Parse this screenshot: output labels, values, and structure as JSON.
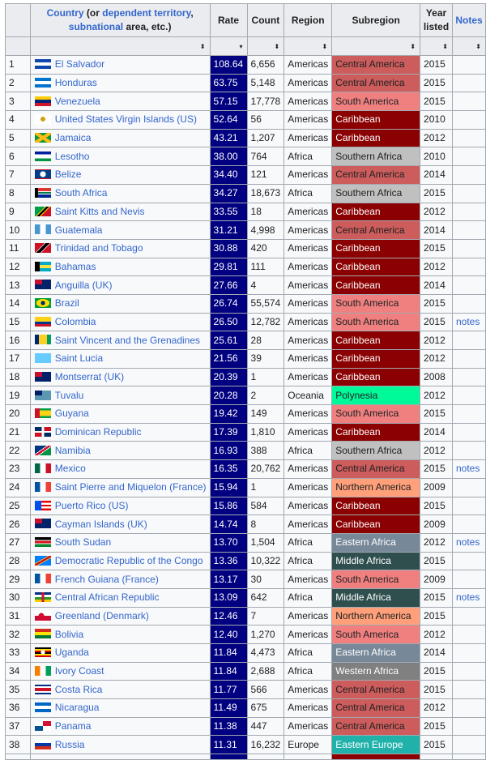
{
  "header": {
    "country_parts": [
      {
        "text": "Country",
        "link": true
      },
      {
        "text": " (or ",
        "link": false
      },
      {
        "text": "dependent territory",
        "link": true
      },
      {
        "text": ",",
        "link": false
      },
      {
        "text": "subnational",
        "link": true
      },
      {
        "text": " area, etc.)",
        "link": false
      }
    ],
    "rate": "Rate",
    "count": "Count",
    "region": "Region",
    "subregion": "Subregion",
    "year_line1": "Year",
    "year_line2": "listed",
    "notes": "Notes",
    "sort_icon": "⬍",
    "sort_desc_icon": "▾"
  },
  "subregion_colors": {
    "Central America": {
      "bg": "#cd5c5c",
      "fg": "#202122"
    },
    "South America": {
      "bg": "#f08080",
      "fg": "#202122"
    },
    "Caribbean": {
      "bg": "#8b0000",
      "fg": "#ffffff"
    },
    "Southern Africa": {
      "bg": "#c0c0c0",
      "fg": "#202122"
    },
    "Polynesia": {
      "bg": "#00fa9a",
      "fg": "#202122"
    },
    "Northern America": {
      "bg": "#ffa07a",
      "fg": "#202122"
    },
    "Eastern Africa": {
      "bg": "#778899",
      "fg": "#ffffff"
    },
    "Middle Africa": {
      "bg": "#2f4f4f",
      "fg": "#ffffff"
    },
    "Western Africa": {
      "bg": "#808080",
      "fg": "#ffffff"
    },
    "Eastern Europe": {
      "bg": "#20b2aa",
      "fg": "#ffffff"
    }
  },
  "rows": [
    {
      "n": "1",
      "country": "El Salvador",
      "flag": "el-salvador",
      "rate": "108.64",
      "count": "6,656",
      "region": "Americas",
      "subregion": "Central America",
      "year": "2015",
      "notes": ""
    },
    {
      "n": "2",
      "country": "Honduras",
      "flag": "honduras",
      "rate": "63.75",
      "count": "5,148",
      "region": "Americas",
      "subregion": "Central America",
      "year": "2015",
      "notes": ""
    },
    {
      "n": "3",
      "country": "Venezuela",
      "flag": "venezuela",
      "rate": "57.15",
      "count": "17,778",
      "region": "Americas",
      "subregion": "South America",
      "year": "2015",
      "notes": ""
    },
    {
      "n": "4",
      "country": "United States Virgin Islands (US)",
      "flag": "usvi",
      "rate": "52.64",
      "count": "56",
      "region": "Americas",
      "subregion": "Caribbean",
      "year": "2010",
      "notes": ""
    },
    {
      "n": "5",
      "country": "Jamaica",
      "flag": "jamaica",
      "rate": "43.21",
      "count": "1,207",
      "region": "Americas",
      "subregion": "Caribbean",
      "year": "2012",
      "notes": ""
    },
    {
      "n": "6",
      "country": "Lesotho",
      "flag": "lesotho",
      "rate": "38.00",
      "count": "764",
      "region": "Africa",
      "subregion": "Southern Africa",
      "year": "2010",
      "notes": ""
    },
    {
      "n": "7",
      "country": "Belize",
      "flag": "belize",
      "rate": "34.40",
      "count": "121",
      "region": "Americas",
      "subregion": "Central America",
      "year": "2014",
      "notes": ""
    },
    {
      "n": "8",
      "country": "South Africa",
      "flag": "south-africa",
      "rate": "34.27",
      "count": "18,673",
      "region": "Africa",
      "subregion": "Southern Africa",
      "year": "2015",
      "notes": ""
    },
    {
      "n": "9",
      "country": "Saint Kitts and Nevis",
      "flag": "saint-kitts",
      "rate": "33.55",
      "count": "18",
      "region": "Americas",
      "subregion": "Caribbean",
      "year": "2012",
      "notes": ""
    },
    {
      "n": "10",
      "country": "Guatemala",
      "flag": "guatemala",
      "rate": "31.21",
      "count": "4,998",
      "region": "Americas",
      "subregion": "Central America",
      "year": "2014",
      "notes": ""
    },
    {
      "n": "11",
      "country": "Trinidad and Tobago",
      "flag": "trinidad",
      "rate": "30.88",
      "count": "420",
      "region": "Americas",
      "subregion": "Caribbean",
      "year": "2015",
      "notes": ""
    },
    {
      "n": "12",
      "country": "Bahamas",
      "flag": "bahamas",
      "rate": "29.81",
      "count": "111",
      "region": "Americas",
      "subregion": "Caribbean",
      "year": "2012",
      "notes": ""
    },
    {
      "n": "13",
      "country": "Anguilla (UK)",
      "flag": "uk-ensign",
      "rate": "27.66",
      "count": "4",
      "region": "Americas",
      "subregion": "Caribbean",
      "year": "2014",
      "notes": ""
    },
    {
      "n": "14",
      "country": "Brazil",
      "flag": "brazil",
      "rate": "26.74",
      "count": "55,574",
      "region": "Americas",
      "subregion": "South America",
      "year": "2015",
      "notes": ""
    },
    {
      "n": "15",
      "country": "Colombia",
      "flag": "colombia",
      "rate": "26.50",
      "count": "12,782",
      "region": "Americas",
      "subregion": "South America",
      "year": "2015",
      "notes": "notes"
    },
    {
      "n": "16",
      "country": "Saint Vincent and the Grenadines",
      "flag": "saint-vincent",
      "rate": "25.61",
      "count": "28",
      "region": "Americas",
      "subregion": "Caribbean",
      "year": "2012",
      "notes": ""
    },
    {
      "n": "17",
      "country": "Saint Lucia",
      "flag": "saint-lucia",
      "rate": "21.56",
      "count": "39",
      "region": "Americas",
      "subregion": "Caribbean",
      "year": "2012",
      "notes": ""
    },
    {
      "n": "18",
      "country": "Montserrat (UK)",
      "flag": "uk-ensign",
      "rate": "20.39",
      "count": "1",
      "region": "Americas",
      "subregion": "Caribbean",
      "year": "2008",
      "notes": ""
    },
    {
      "n": "19",
      "country": "Tuvalu",
      "flag": "tuvalu",
      "rate": "20.28",
      "count": "2",
      "region": "Oceania",
      "subregion": "Polynesia",
      "year": "2012",
      "notes": ""
    },
    {
      "n": "20",
      "country": "Guyana",
      "flag": "guyana",
      "rate": "19.42",
      "count": "149",
      "region": "Americas",
      "subregion": "South America",
      "year": "2015",
      "notes": ""
    },
    {
      "n": "21",
      "country": "Dominican Republic",
      "flag": "dominican",
      "rate": "17.39",
      "count": "1,810",
      "region": "Americas",
      "subregion": "Caribbean",
      "year": "2014",
      "notes": ""
    },
    {
      "n": "22",
      "country": "Namibia",
      "flag": "namibia",
      "rate": "16.93",
      "count": "388",
      "region": "Africa",
      "subregion": "Southern Africa",
      "year": "2012",
      "notes": ""
    },
    {
      "n": "23",
      "country": "Mexico",
      "flag": "mexico",
      "rate": "16.35",
      "count": "20,762",
      "region": "Americas",
      "subregion": "Central America",
      "year": "2015",
      "notes": "notes"
    },
    {
      "n": "24",
      "country": "Saint Pierre and Miquelon (France)",
      "flag": "france",
      "rate": "15.94",
      "count": "1",
      "region": "Americas",
      "subregion": "Northern America",
      "year": "2009",
      "notes": ""
    },
    {
      "n": "25",
      "country": "Puerto Rico (US)",
      "flag": "puerto-rico",
      "rate": "15.86",
      "count": "584",
      "region": "Americas",
      "subregion": "Caribbean",
      "year": "2015",
      "notes": ""
    },
    {
      "n": "26",
      "country": "Cayman Islands (UK)",
      "flag": "uk-ensign",
      "rate": "14.74",
      "count": "8",
      "region": "Americas",
      "subregion": "Caribbean",
      "year": "2009",
      "notes": ""
    },
    {
      "n": "27",
      "country": "South Sudan",
      "flag": "south-sudan",
      "rate": "13.70",
      "count": "1,504",
      "region": "Africa",
      "subregion": "Eastern Africa",
      "year": "2012",
      "notes": "notes"
    },
    {
      "n": "28",
      "country": "Democratic Republic of the Congo",
      "flag": "drc",
      "rate": "13.36",
      "count": "10,322",
      "region": "Africa",
      "subregion": "Middle Africa",
      "year": "2015",
      "notes": ""
    },
    {
      "n": "29",
      "country": "French Guiana (France)",
      "flag": "france",
      "rate": "13.17",
      "count": "30",
      "region": "Americas",
      "subregion": "South America",
      "year": "2009",
      "notes": ""
    },
    {
      "n": "30",
      "country": "Central African Republic",
      "flag": "car",
      "rate": "13.09",
      "count": "642",
      "region": "Africa",
      "subregion": "Middle Africa",
      "year": "2015",
      "notes": "notes"
    },
    {
      "n": "31",
      "country": "Greenland (Denmark)",
      "flag": "greenland",
      "rate": "12.46",
      "count": "7",
      "region": "Americas",
      "subregion": "Northern America",
      "year": "2015",
      "notes": ""
    },
    {
      "n": "32",
      "country": "Bolivia",
      "flag": "bolivia",
      "rate": "12.40",
      "count": "1,270",
      "region": "Americas",
      "subregion": "South America",
      "year": "2012",
      "notes": ""
    },
    {
      "n": "33",
      "country": "Uganda",
      "flag": "uganda",
      "rate": "11.84",
      "count": "4,473",
      "region": "Africa",
      "subregion": "Eastern Africa",
      "year": "2014",
      "notes": ""
    },
    {
      "n": "34",
      "country": "Ivory Coast",
      "flag": "ivory-coast",
      "rate": "11.84",
      "count": "2,688",
      "region": "Africa",
      "subregion": "Western Africa",
      "year": "2015",
      "notes": ""
    },
    {
      "n": "35",
      "country": "Costa Rica",
      "flag": "costa-rica",
      "rate": "11.77",
      "count": "566",
      "region": "Americas",
      "subregion": "Central America",
      "year": "2015",
      "notes": ""
    },
    {
      "n": "36",
      "country": "Nicaragua",
      "flag": "nicaragua",
      "rate": "11.49",
      "count": "675",
      "region": "Americas",
      "subregion": "Central America",
      "year": "2012",
      "notes": ""
    },
    {
      "n": "37",
      "country": "Panama",
      "flag": "panama",
      "rate": "11.38",
      "count": "447",
      "region": "Americas",
      "subregion": "Central America",
      "year": "2015",
      "notes": ""
    },
    {
      "n": "38",
      "country": "Russia",
      "flag": "russia",
      "rate": "11.31",
      "count": "16,232",
      "region": "Europe",
      "subregion": "Eastern Europe",
      "year": "2015",
      "notes": ""
    }
  ],
  "partial_next_row": {
    "subregion": "Caribbean"
  }
}
